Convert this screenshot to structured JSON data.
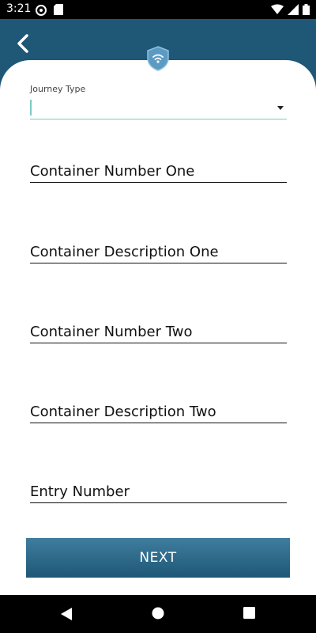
{
  "status_bar": {
    "time": "3:21",
    "icons": [
      "at-sign-icon",
      "sd-card-icon",
      "wifi-icon",
      "battery-icon"
    ]
  },
  "header": {
    "back_icon": "chevron-left-icon",
    "logo_icon": "shield-wifi-logo-icon",
    "color": "#1f5776"
  },
  "form": {
    "journey_type": {
      "label": "Journey Type",
      "value": ""
    },
    "container_number_one": {
      "placeholder": "Container Number One",
      "value": ""
    },
    "container_description_one": {
      "placeholder": "Container Description One",
      "value": ""
    },
    "container_number_two": {
      "placeholder": "Container Number Two",
      "value": ""
    },
    "container_description_two": {
      "placeholder": "Container Description Two",
      "value": ""
    },
    "entry_number": {
      "placeholder": "Entry Number",
      "value": ""
    }
  },
  "next_button": {
    "label": "NEXT"
  },
  "nav_bar": {
    "icons": [
      "back-triangle-icon",
      "home-circle-icon",
      "recents-square-icon"
    ]
  },
  "colors": {
    "accent": "#1f5776",
    "field_focus": "#7ccac3"
  }
}
